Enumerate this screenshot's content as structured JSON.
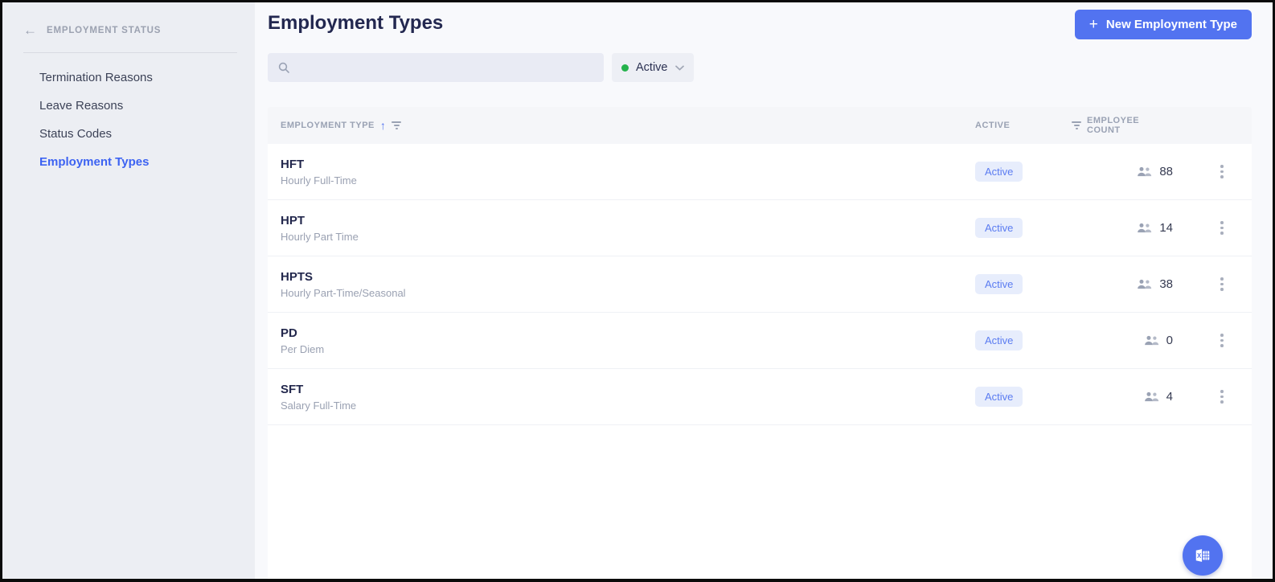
{
  "sidebar": {
    "back_label": "EMPLOYMENT STATUS",
    "items": [
      {
        "label": "Termination Reasons"
      },
      {
        "label": "Leave Reasons"
      },
      {
        "label": "Status Codes"
      },
      {
        "label": "Employment Types",
        "active": true
      }
    ]
  },
  "header": {
    "title": "Employment Types",
    "new_button_label": "New Employment Type"
  },
  "icons": {
    "plus": "+",
    "back_arrow": "←",
    "sort_ascending": "↑"
  },
  "filters": {
    "search": {
      "value": "",
      "placeholder": ""
    },
    "status": {
      "selected": "Active",
      "dot_color": "#24b24c"
    }
  },
  "table": {
    "columns": {
      "employment_type": "EMPLOYMENT TYPE",
      "active": "ACTIVE",
      "employee_count": "EMPLOYEE COUNT"
    },
    "rows": [
      {
        "code": "HFT",
        "description": "Hourly Full-Time",
        "status": "Active",
        "employee_count": 88
      },
      {
        "code": "HPT",
        "description": "Hourly Part Time",
        "status": "Active",
        "employee_count": 14
      },
      {
        "code": "HPTS",
        "description": "Hourly Part-Time/Seasonal",
        "status": "Active",
        "employee_count": 38
      },
      {
        "code": "PD",
        "description": "Per Diem",
        "status": "Active",
        "employee_count": 0
      },
      {
        "code": "SFT",
        "description": "Salary Full-Time",
        "status": "Active",
        "employee_count": 4
      }
    ]
  },
  "colors": {
    "accent_blue": "#5273f0",
    "sidebar_active_blue": "#3d63f2",
    "badge_bg": "#e7edfc",
    "badge_text": "#5b7cf1",
    "active_dot_green": "#24b24c",
    "title_navy": "#232850"
  }
}
